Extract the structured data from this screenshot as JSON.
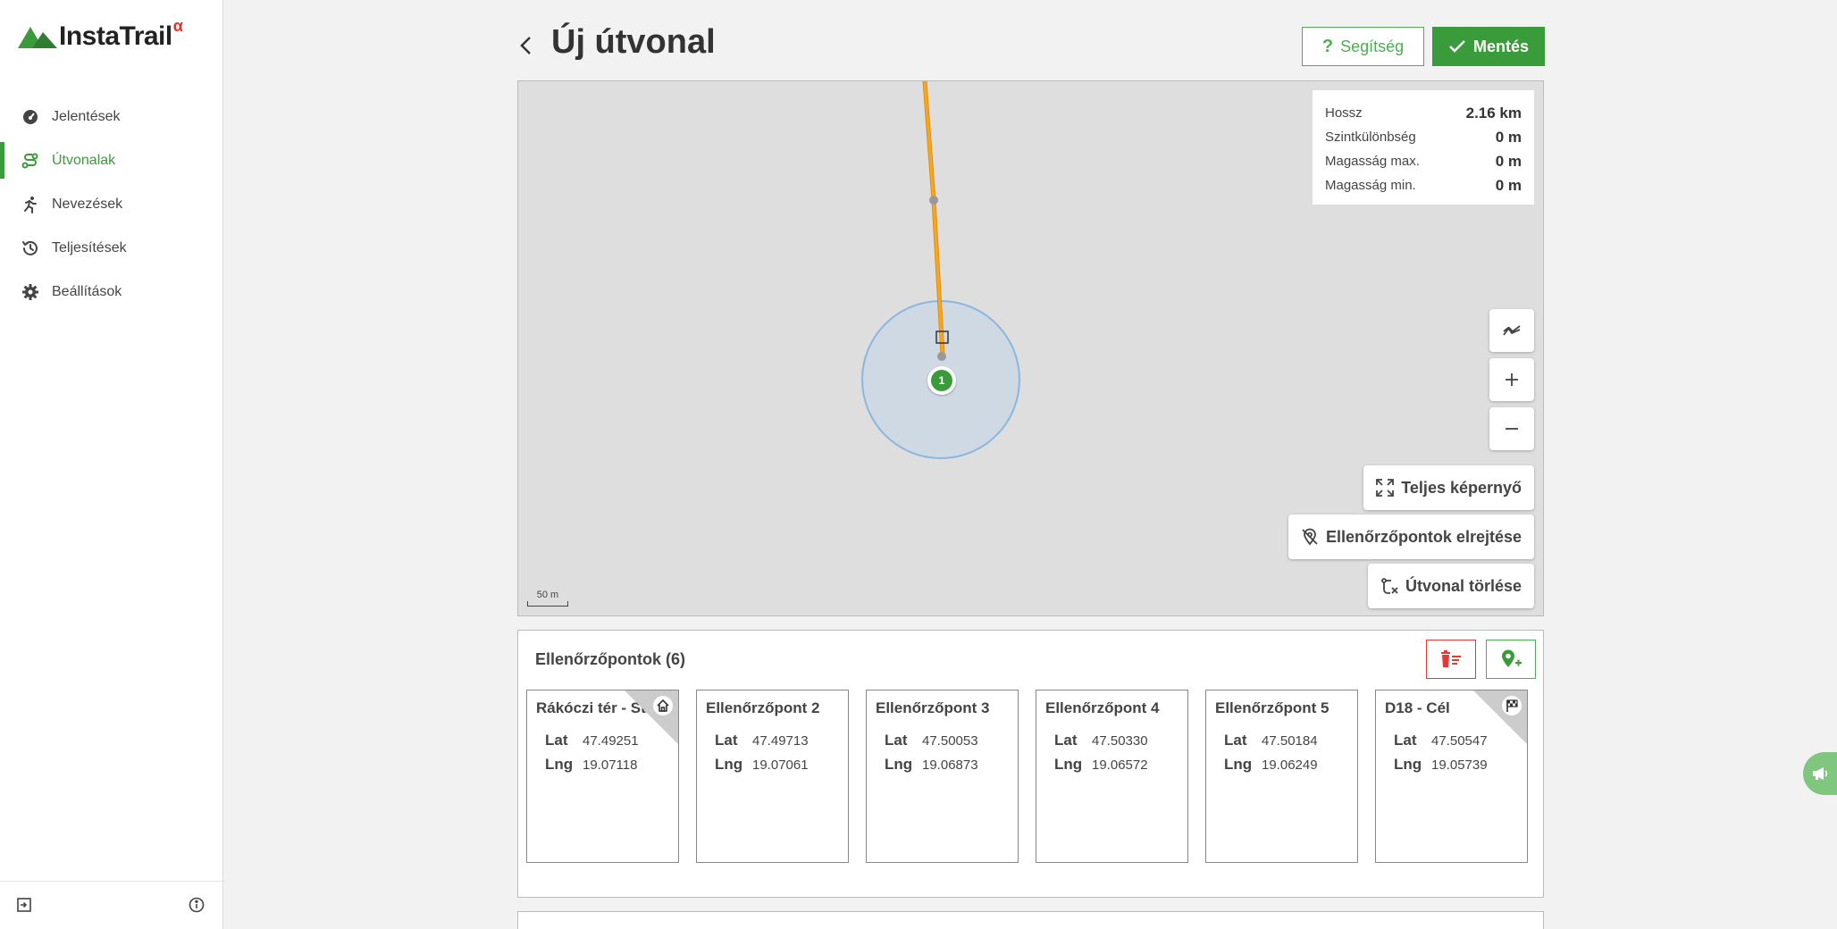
{
  "app": {
    "logo_text": "InstaTrail",
    "logo_alpha": "α",
    "accent": "#3a9b3a",
    "danger": "#e53935"
  },
  "sidebar": {
    "items": [
      {
        "label": "Jelentések",
        "icon": "dashboard-icon",
        "active": false
      },
      {
        "label": "Útvonalak",
        "icon": "route-icon",
        "active": true
      },
      {
        "label": "Nevezések",
        "icon": "runner-icon",
        "active": false
      },
      {
        "label": "Teljesítések",
        "icon": "history-icon",
        "active": false
      },
      {
        "label": "Beállítások",
        "icon": "gear-icon",
        "active": false
      }
    ],
    "bottom_left_icon": "logout-icon",
    "bottom_right_icon": "info-icon"
  },
  "header": {
    "title": "Új útvonal",
    "help_label": "Segítség",
    "save_label": "Mentés"
  },
  "map": {
    "stats": [
      {
        "label": "Hossz",
        "value": "2.16 km"
      },
      {
        "label": "Szintkülönbség",
        "value": "0 m"
      },
      {
        "label": "Magasság max.",
        "value": "0 m"
      },
      {
        "label": "Magasság min.",
        "value": "0 m"
      }
    ],
    "marker_label": "1",
    "fullscreen_label": "Teljes képernyő",
    "hide_checkpoints_label": "Ellenőrzőpontok elrejtése",
    "delete_route_label": "Útvonal törlése",
    "scale_label": "50 m"
  },
  "checkpoints": {
    "title": "Ellenőrzőpontok (6)",
    "lat_key": "Lat",
    "lng_key": "Lng",
    "items": [
      {
        "name": "Rákóczi tér - Start",
        "lat": "47.49251",
        "lng": "19.07118",
        "corner_icon": "home-icon"
      },
      {
        "name": "Ellenőrzőpont 2",
        "lat": "47.49713",
        "lng": "19.07061"
      },
      {
        "name": "Ellenőrzőpont 3",
        "lat": "47.50053",
        "lng": "19.06873"
      },
      {
        "name": "Ellenőrzőpont 4",
        "lat": "47.50330",
        "lng": "19.06572"
      },
      {
        "name": "Ellenőrzőpont 5",
        "lat": "47.50184",
        "lng": "19.06249"
      },
      {
        "name": "D18 - Cél",
        "lat": "47.50547",
        "lng": "19.05739",
        "corner_icon": "finish-flag-icon"
      }
    ]
  }
}
